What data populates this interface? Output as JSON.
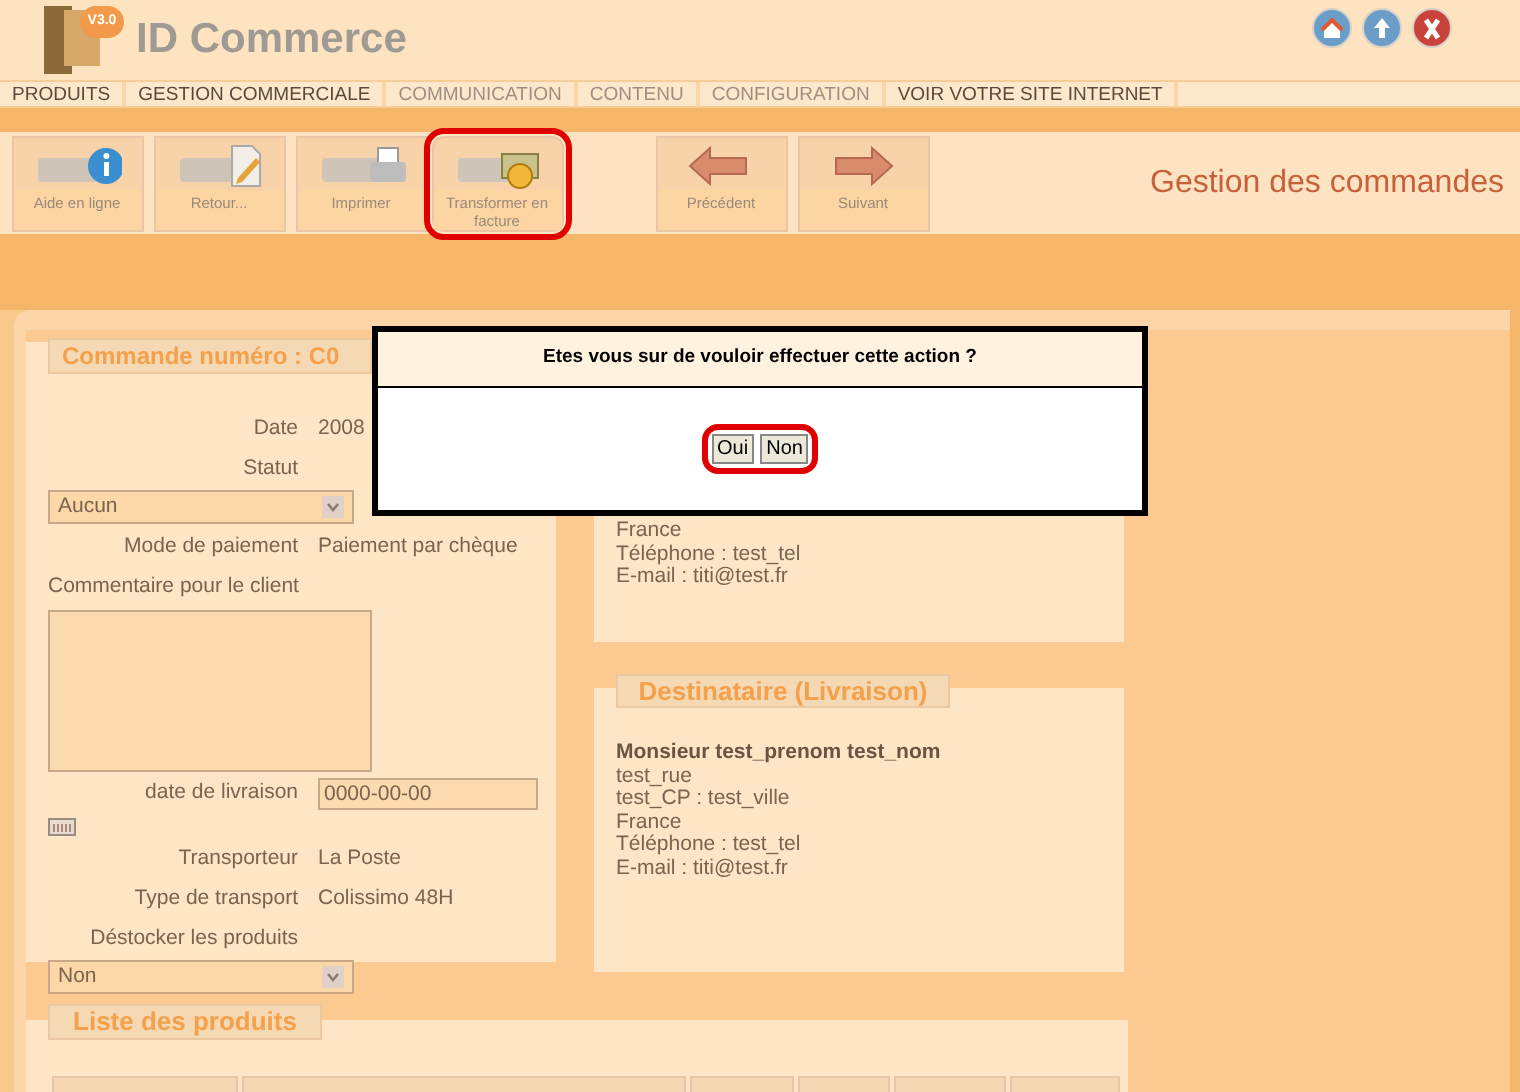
{
  "app": {
    "logo_badge": "V3.0",
    "title": "ID Commerce"
  },
  "nav": [
    {
      "label": "PRODUITS",
      "active": true
    },
    {
      "label": "GESTION COMMERCIALE",
      "active": true
    },
    {
      "label": "COMMUNICATION",
      "active": false
    },
    {
      "label": "CONTENU",
      "active": false
    },
    {
      "label": "CONFIGURATION",
      "active": false
    },
    {
      "label": "VOIR VOTRE SITE INTERNET",
      "active": true
    }
  ],
  "toolbar_actions": [
    {
      "kind": "info",
      "label": "Aide en ligne",
      "highlighted": false
    },
    {
      "kind": "edit",
      "label": "Retour...",
      "highlighted": false
    },
    {
      "kind": "print",
      "label": "Imprimer",
      "highlighted": false
    },
    {
      "kind": "money",
      "label": "Transformer en facture",
      "highlighted": true
    }
  ],
  "toolbar_navigation": [
    {
      "kind": "previous",
      "label": "Précédent"
    },
    {
      "kind": "next",
      "label": "Suivant"
    }
  ],
  "page_title": "Gestion des commandes",
  "order": {
    "title": "Commande numéro : C0",
    "date_label": "Date",
    "date_value": "2008",
    "status_label": "Statut",
    "status_value": "Aucun",
    "payment_label": "Mode de paiement",
    "payment_value": "Paiement par chèque",
    "comment_label": "Commentaire pour le client",
    "delivery_date_label": "date de livraison",
    "delivery_date_value": "0000-00-00",
    "carrier_label": "Transporteur",
    "carrier_value": "La Poste",
    "transport_label": "Type de transport",
    "transport_value": "Colissimo 48H",
    "destock_label": "Déstocker les produits",
    "destock_value": "Non"
  },
  "billing": {
    "lines": [
      "France",
      "Téléphone : test_tel",
      "E-mail : titi@test.fr"
    ]
  },
  "shipping": {
    "title": "Destinataire (Livraison)",
    "name": "Monsieur test_prenom test_nom",
    "lines": [
      "test_rue",
      "test_CP : test_ville",
      "France",
      "Téléphone : test_tel",
      "E-mail : titi@test.fr"
    ]
  },
  "products": {
    "title": "Liste des produits"
  },
  "dialog": {
    "message": "Etes vous sur de vouloir effectuer cette action ?",
    "buttons": [
      "Oui",
      "Non"
    ],
    "highlighted": true
  }
}
